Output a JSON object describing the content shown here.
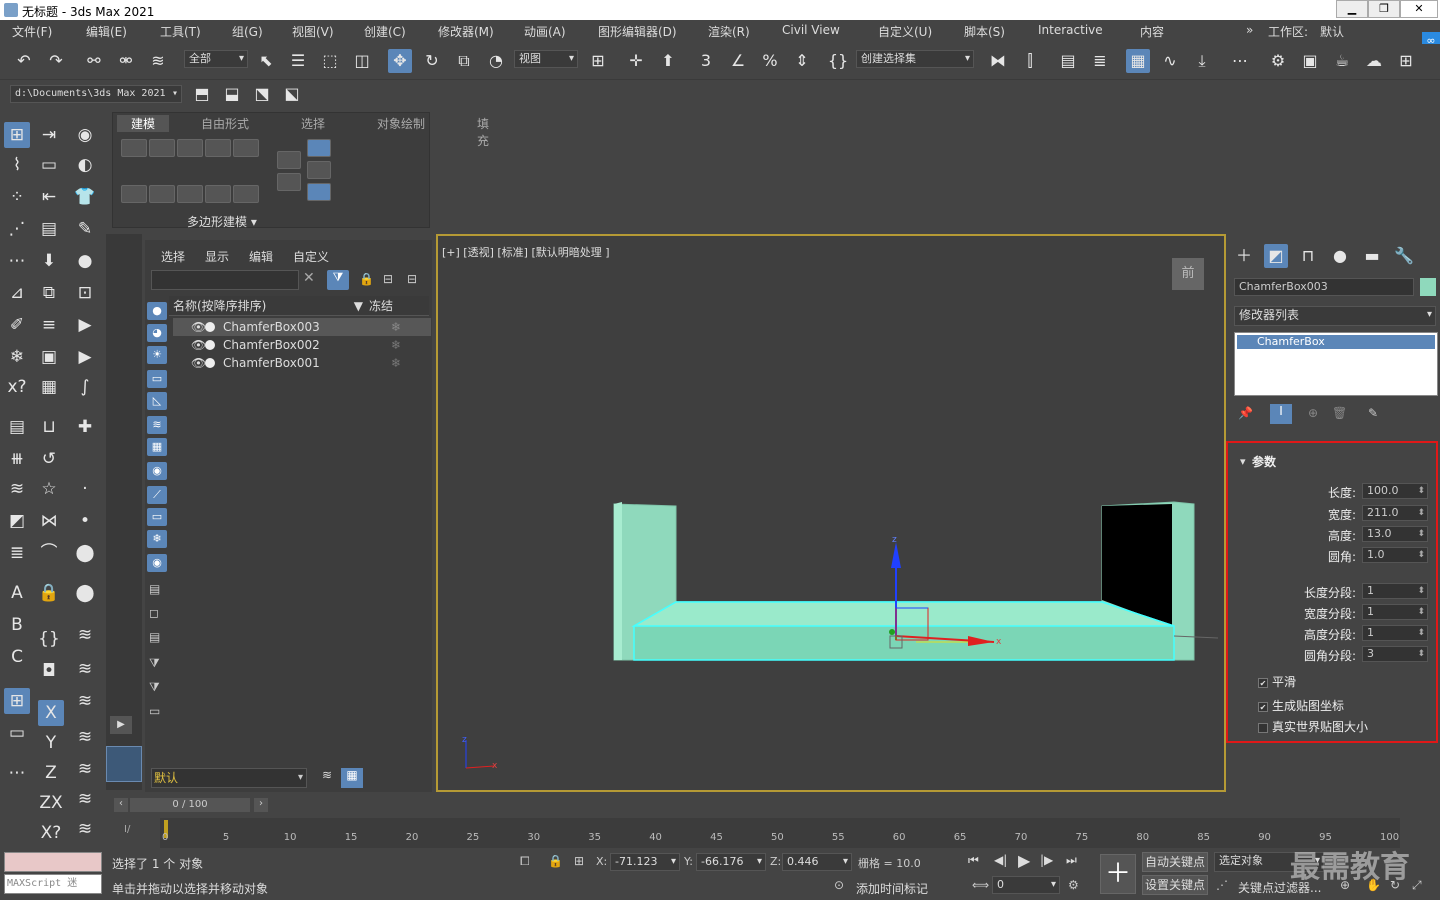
{
  "window": {
    "title": "无标题 - 3ds Max 2021",
    "min": "▁",
    "max": "❐",
    "close": "✕"
  },
  "menu": [
    "文件(F)",
    "编辑(E)",
    "工具(T)",
    "组(G)",
    "视图(V)",
    "创建(C)",
    "修改器(M)",
    "动画(A)",
    "图形编辑器(D)",
    "渲染(R)",
    "Civil View",
    "自定义(U)",
    "脚本(S)",
    "Interactive",
    "内容"
  ],
  "workspace": {
    "label": "工作区:",
    "value": "默认"
  },
  "toolbar": {
    "selection_filter": "全部",
    "ref_coord": "视图",
    "named_selection": "创建选择集"
  },
  "project_path": "d:\\Documents\\3ds Max 2021",
  "ribbon": {
    "tabs": [
      "建模",
      "自由形式",
      "选择",
      "对象绘制",
      "填充"
    ],
    "panel_label": "多边形建模 ▾"
  },
  "scene_explorer": {
    "menus": [
      "选择",
      "显示",
      "编辑",
      "自定义"
    ],
    "col_name": "名称(按降序排序)",
    "col_freeze": "冻结",
    "objects": [
      "ChamferBox003",
      "ChamferBox002",
      "ChamferBox001"
    ],
    "layer": "默认"
  },
  "viewport": {
    "label": "[+] [透视] [标准] [默认明暗处理 ]",
    "viewcube": "前"
  },
  "command_panel": {
    "object_name": "ChamferBox003",
    "modifier_list": "修改器列表",
    "stack_item": "ChamferBox",
    "rollout_title": "参数",
    "params": [
      {
        "label": "长度:",
        "value": "100.0"
      },
      {
        "label": "宽度:",
        "value": "211.0"
      },
      {
        "label": "高度:",
        "value": "13.0"
      },
      {
        "label": "圆角:",
        "value": "1.0"
      },
      {
        "label": "长度分段:",
        "value": "1"
      },
      {
        "label": "宽度分段:",
        "value": "1"
      },
      {
        "label": "高度分段:",
        "value": "1"
      },
      {
        "label": "圆角分段:",
        "value": "3"
      }
    ],
    "checks": [
      {
        "label": "平滑",
        "checked": true
      },
      {
        "label": "生成贴图坐标",
        "checked": true
      },
      {
        "label": "真实世界贴图大小",
        "checked": false
      }
    ]
  },
  "timeline": {
    "frame": "0 / 100",
    "ticks": [
      "0",
      "5",
      "10",
      "15",
      "20",
      "25",
      "30",
      "35",
      "40",
      "45",
      "50",
      "55",
      "60",
      "65",
      "70",
      "75",
      "80",
      "85",
      "90",
      "95",
      "100"
    ]
  },
  "status": {
    "selected": "选择了 1 个 对象",
    "hint": "单击并拖动以选择并移动对象",
    "maxscript": "MAXScript 迷",
    "x_label": "X:",
    "x": "-71.123",
    "y_label": "Y:",
    "y": "-66.176",
    "z_label": "Z:",
    "z": "0.446",
    "grid": "栅格 = 10.0",
    "add_time_tag": "添加时间标记",
    "auto_key": "自动关键点",
    "selected_obj": "选定对象",
    "set_key": "设置关键点",
    "key_filter": "关键点过滤器...",
    "frame_field": "0"
  },
  "watermark": "最需教育",
  "colors": {
    "accent": "#5b86b8",
    "highlight_box": "#e01818",
    "viewport_border": "#b59a35",
    "object": "#8fe0c0"
  }
}
